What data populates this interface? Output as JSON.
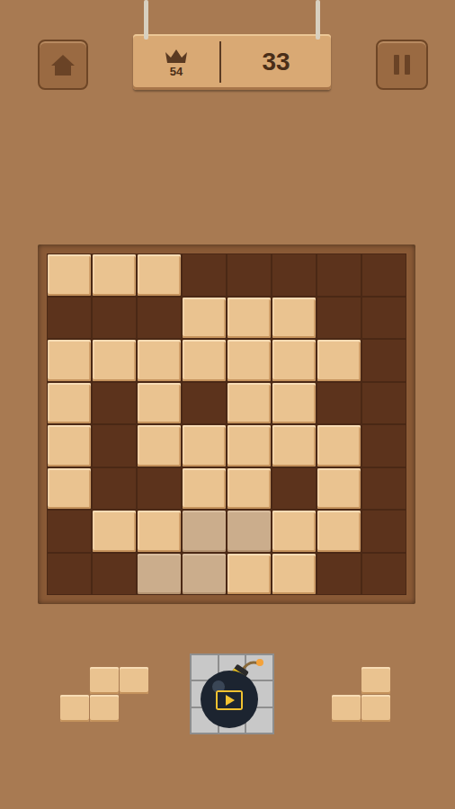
{
  "header": {
    "best": "54",
    "score": "33"
  },
  "board": {
    "rows": [
      [
        "filled",
        "filled",
        "filled",
        "empty",
        "empty",
        "empty",
        "empty",
        "empty"
      ],
      [
        "empty",
        "empty",
        "empty",
        "filled",
        "filled",
        "filled",
        "empty",
        "empty"
      ],
      [
        "filled",
        "filled",
        "filled",
        "filled",
        "filled",
        "filled",
        "filled",
        "empty"
      ],
      [
        "filled",
        "empty",
        "filled",
        "empty",
        "filled",
        "filled",
        "empty",
        "empty"
      ],
      [
        "filled",
        "empty",
        "filled",
        "filled",
        "filled",
        "filled",
        "filled",
        "empty"
      ],
      [
        "filled",
        "empty",
        "empty",
        "filled",
        "filled",
        "empty",
        "filled",
        "empty"
      ],
      [
        "empty",
        "filled",
        "filled",
        "preview",
        "preview",
        "filled",
        "filled",
        "empty"
      ],
      [
        "empty",
        "empty",
        "preview",
        "preview",
        "filled",
        "filled",
        "empty",
        "empty"
      ]
    ]
  },
  "tray": [
    {
      "kind": "piece",
      "shape": [
        [
          false,
          true,
          true
        ],
        [
          true,
          true,
          false
        ]
      ]
    },
    {
      "kind": "bomb"
    },
    {
      "kind": "piece",
      "shape": [
        [
          false,
          true
        ],
        [
          true,
          true
        ]
      ]
    }
  ]
}
